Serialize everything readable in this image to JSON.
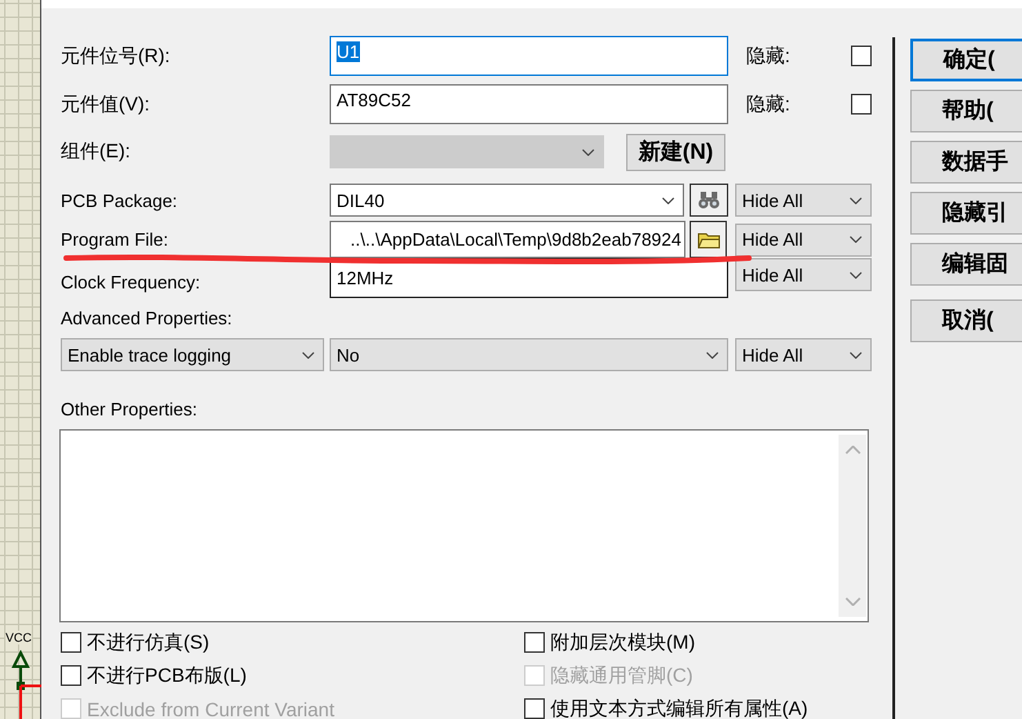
{
  "schematic": {
    "net_label": "VCC"
  },
  "properties": [
    {
      "kind": "text",
      "label": "元件位号(R):",
      "value": "U1",
      "focused": true,
      "hide_label": "隐藏:",
      "hidden": false
    },
    {
      "kind": "text",
      "label": "元件值(V):",
      "value": "AT89C52",
      "focused": false,
      "hide_label": "隐藏:",
      "hidden": false
    },
    {
      "kind": "component",
      "label": "组件(E):",
      "disabled": true,
      "button": "新建(N)"
    },
    {
      "kind": "package",
      "label": "PCB Package:",
      "value": "DIL40",
      "visibility": "Hide All"
    },
    {
      "kind": "file",
      "label": "Program File:",
      "value": "..\\..\\AppData\\Local\\Temp\\9d8b2eab78924",
      "visibility": "Hide All"
    },
    {
      "kind": "plain",
      "label": "Clock Frequency:",
      "value": "12MHz",
      "visibility": "Hide All"
    }
  ],
  "advanced": {
    "label": "Advanced Properties:",
    "property": "Enable trace logging",
    "value": "No",
    "visibility": "Hide All"
  },
  "other": {
    "label": "Other Properties:"
  },
  "options_left": [
    {
      "label": "不进行仿真(S)",
      "checked": false,
      "disabled": false
    },
    {
      "label": "不进行PCB布版(L)",
      "checked": false,
      "disabled": false
    },
    {
      "label": "Exclude from Current Variant",
      "checked": false,
      "disabled": true
    }
  ],
  "options_right": [
    {
      "label": "附加层次模块(M)",
      "checked": false,
      "disabled": false
    },
    {
      "label": "隐藏通用管脚(C)",
      "checked": false,
      "disabled": true
    },
    {
      "label": "使用文本方式编辑所有属性(A)",
      "checked": false,
      "disabled": false
    }
  ],
  "buttons": [
    {
      "label": "确定(",
      "default": true
    },
    {
      "label": "帮助(",
      "default": false
    },
    {
      "label": "数据手",
      "default": false
    },
    {
      "label": "隐藏引",
      "default": false
    },
    {
      "label": "编辑固",
      "default": false
    },
    {
      "label": "取消(",
      "default": false
    }
  ]
}
